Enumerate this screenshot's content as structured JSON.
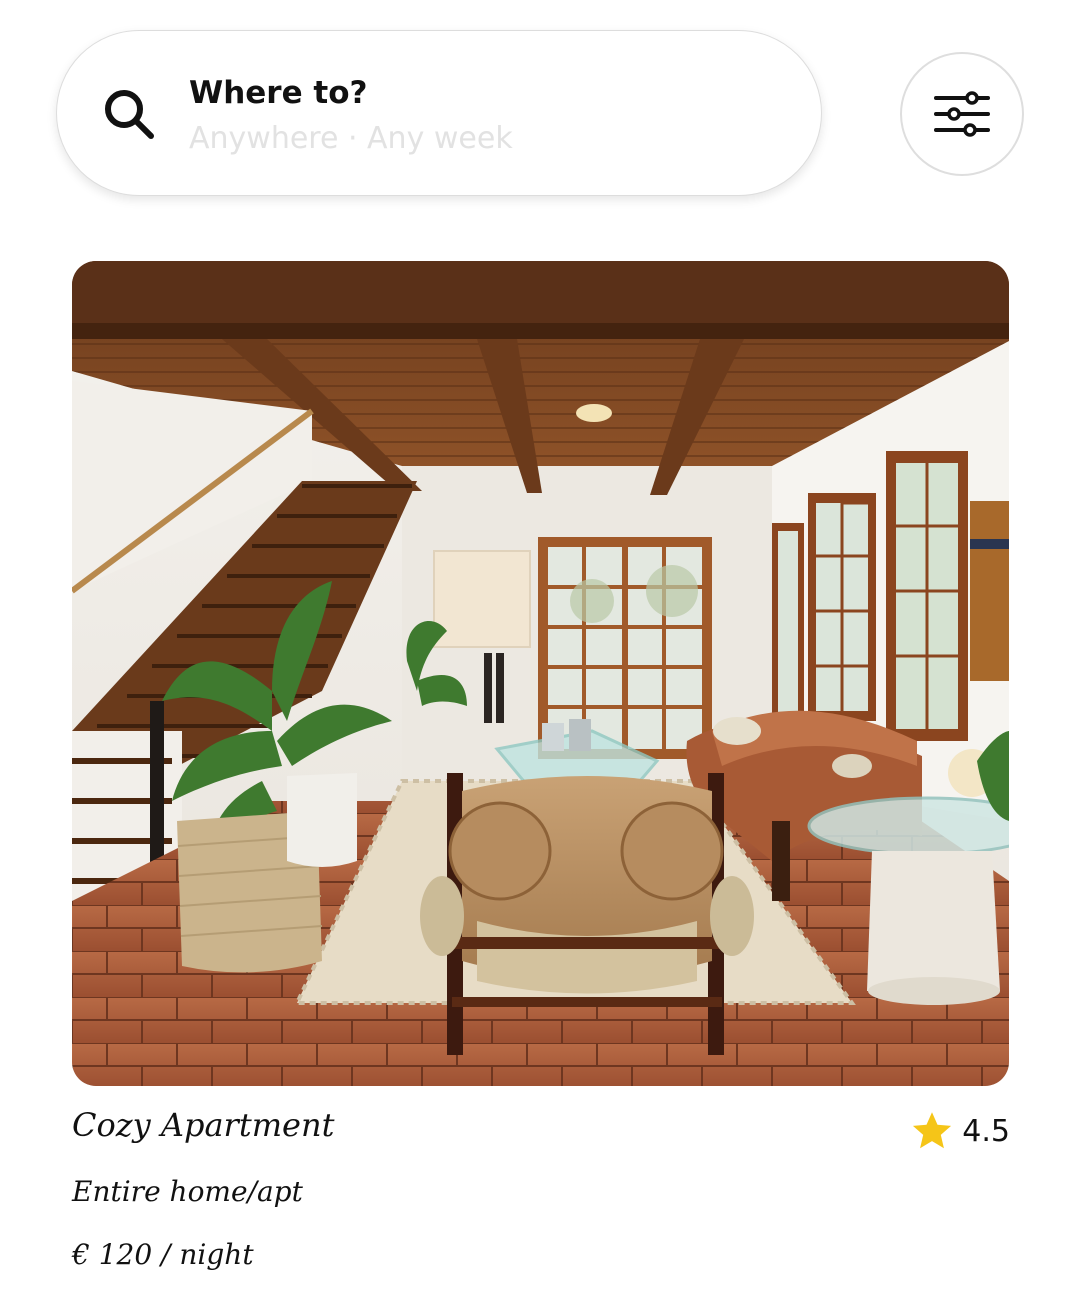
{
  "search": {
    "title": "Where to?",
    "subtitle": "Anywhere · Any week",
    "icon": "search-icon"
  },
  "filters": {
    "icon": "sliders-icon"
  },
  "listing": {
    "photo": "living-room-photo",
    "title": "Cozy Apartment",
    "rating": "4.5",
    "rating_icon": "star-icon",
    "rating_color": "#f5c518",
    "type": "Entire home/apt",
    "price": "€ 120 / night"
  }
}
